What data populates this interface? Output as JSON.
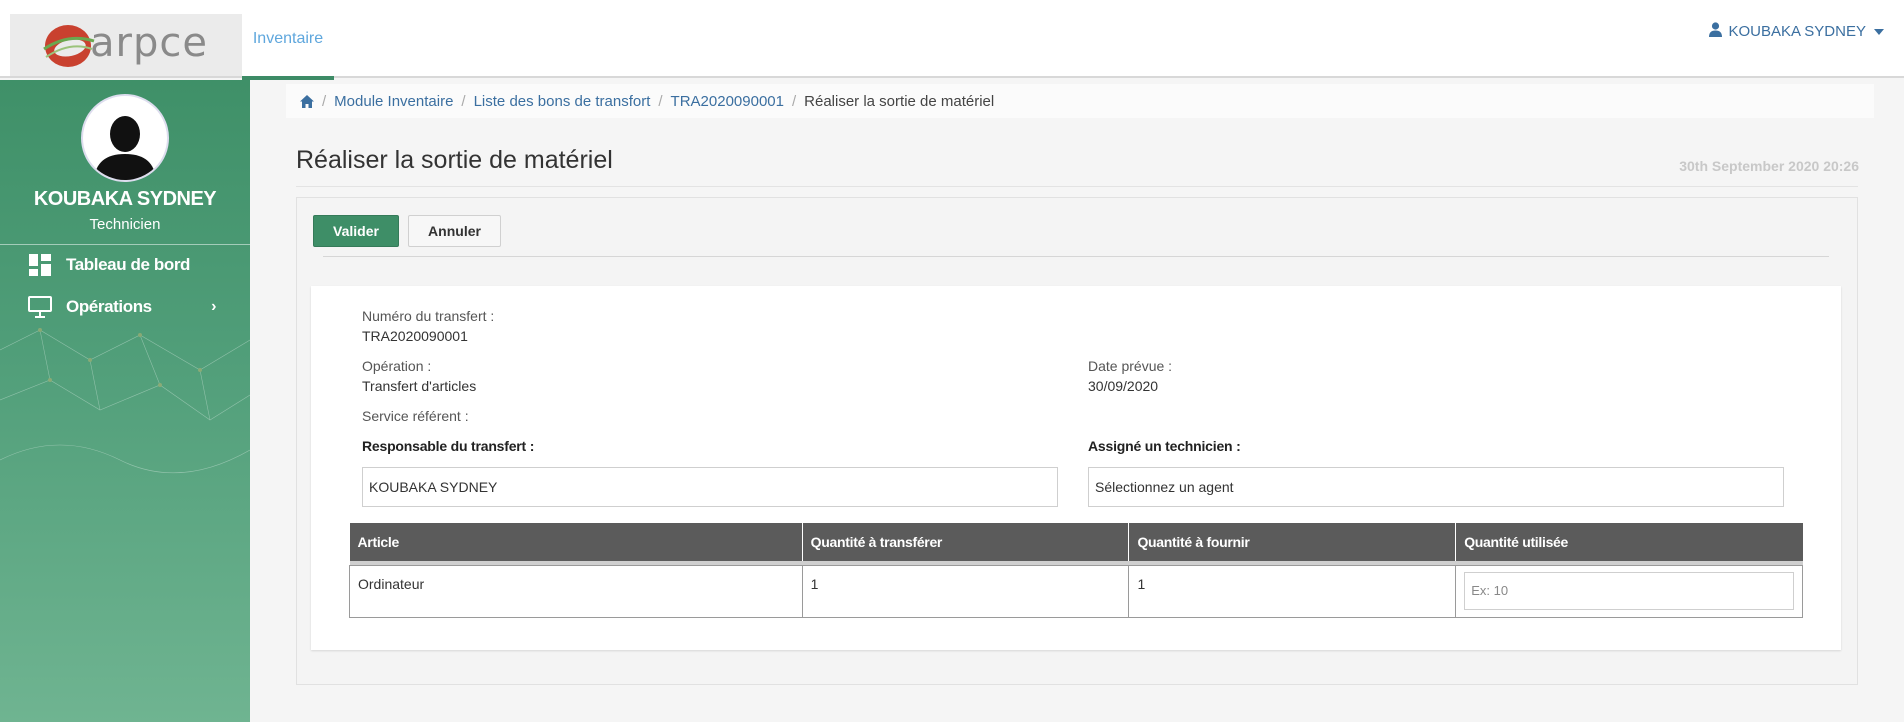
{
  "brand": {
    "logo_text": "arpce"
  },
  "topnav": {
    "active_tab": "Inventaire"
  },
  "user_menu": {
    "name": "KOUBAKA SYDNEY"
  },
  "sidebar": {
    "user_name": "KOUBAKA SYDNEY",
    "user_role": "Technicien",
    "items": [
      {
        "label": "Tableau de bord",
        "icon": "dashboard-icon"
      },
      {
        "label": "Opérations",
        "icon": "monitor-icon",
        "has_submenu": true
      }
    ]
  },
  "breadcrumb": {
    "items": [
      "Module Inventaire",
      "Liste des bons de transfort",
      "TRA2020090001"
    ],
    "current": "Réaliser la sortie de matériel"
  },
  "page": {
    "title": "Réaliser la sortie de matériel",
    "date": "30th September 2020 20:26"
  },
  "actions": {
    "validate_label": "Valider",
    "cancel_label": "Annuler"
  },
  "form": {
    "transfer_number_label": "Numéro du transfert :",
    "transfer_number": "TRA2020090001",
    "operation_label": "Opération :",
    "operation": "Transfert d'articles",
    "planned_date_label": "Date prévue :",
    "planned_date": "30/09/2020",
    "service_label": "Service référent :",
    "responsible_label": "Responsable du transfert :",
    "responsible_value": "KOUBAKA SYDNEY",
    "technician_label": "Assigné un technicien :",
    "technician_placeholder": "Sélectionnez un agent"
  },
  "table": {
    "headers": [
      "Article",
      "Quantité à transférer",
      "Quantité à fournir",
      "Quantité utilisée"
    ],
    "rows": [
      {
        "article": "Ordinateur",
        "qty_transfer": "1",
        "qty_supply": "1",
        "qty_used_placeholder": "Ex: 10"
      }
    ]
  },
  "colors": {
    "accent_green": "#3e8e67",
    "link_blue": "#3b6fa0",
    "tab_blue": "#5fa7dd"
  }
}
